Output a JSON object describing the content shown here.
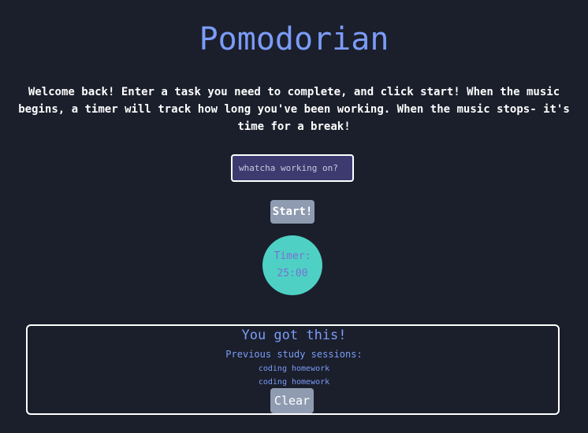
{
  "header": {
    "title": "Pomodorian"
  },
  "intro": {
    "text": "Welcome back! Enter a task you need to complete, and click start! When the music begins, a timer will track how long you've been working. When the music stops- it's time for a break!"
  },
  "task": {
    "placeholder": "whatcha working on?",
    "value": ""
  },
  "controls": {
    "start_label": "Start!",
    "clear_label": "Clear"
  },
  "timer": {
    "label": "Timer:",
    "time": "25:00"
  },
  "sessions": {
    "motivation": "You got this!",
    "heading": "Previous study sessions:",
    "items": [
      "coding homework",
      "coding homework"
    ]
  },
  "colors": {
    "background": "#1b1f2b",
    "accent": "#7b9cf7",
    "timer_circle": "#4ed1c4",
    "timer_text": "#7a6fd6",
    "input_bg": "#3c3a6e",
    "button_bg": "#8f9bb0"
  }
}
